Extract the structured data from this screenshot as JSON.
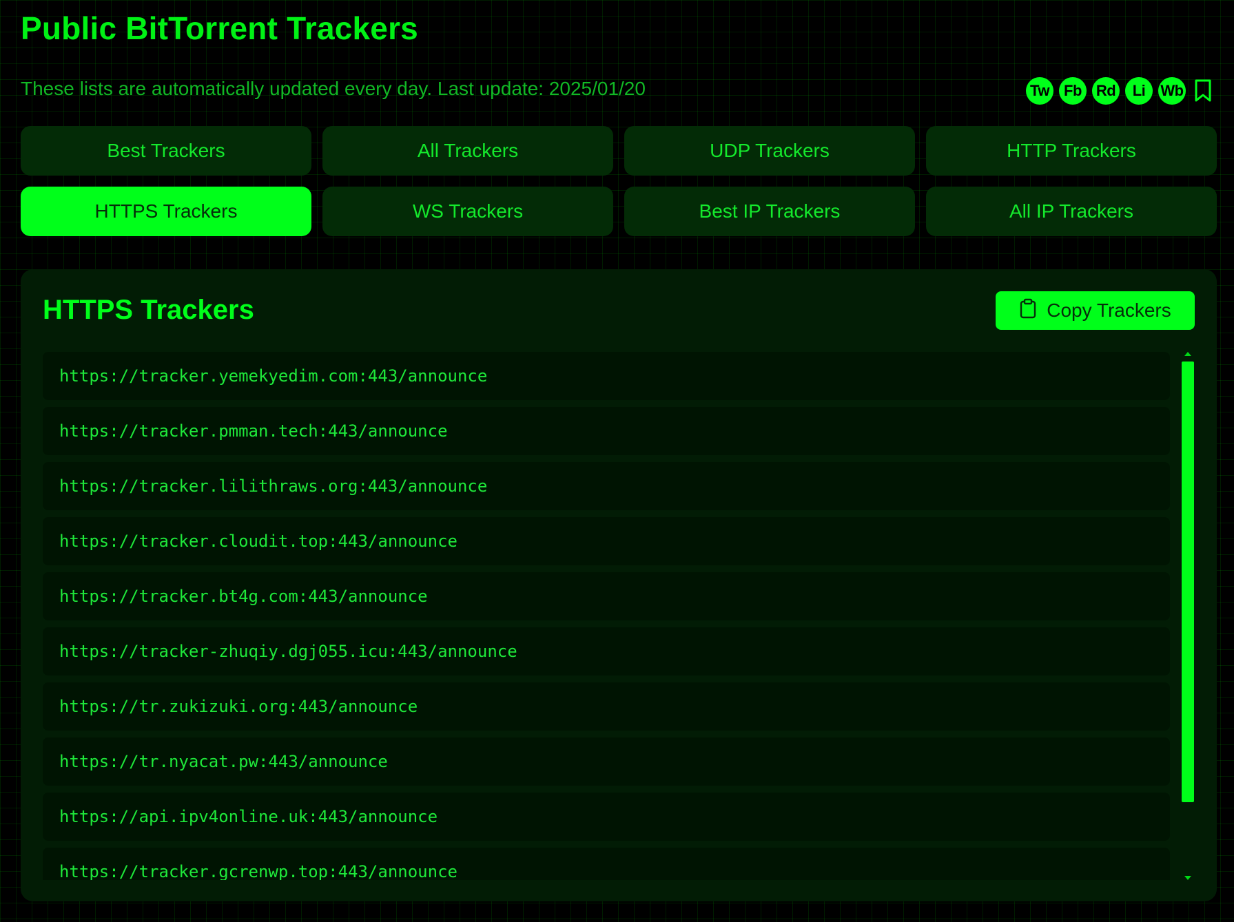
{
  "header": {
    "title": "Public BitTorrent Trackers",
    "subtitle": "These lists are automatically updated every day. Last update: 2025/01/20"
  },
  "share": {
    "icons": [
      {
        "label": "Tw",
        "name": "twitter-icon"
      },
      {
        "label": "Fb",
        "name": "facebook-icon"
      },
      {
        "label": "Rd",
        "name": "reddit-icon"
      },
      {
        "label": "Li",
        "name": "linkedin-icon"
      },
      {
        "label": "Wb",
        "name": "weibo-icon"
      }
    ],
    "bookmark_icon": "bookmark-icon"
  },
  "tabs": [
    {
      "label": "Best Trackers",
      "active": false
    },
    {
      "label": "All Trackers",
      "active": false
    },
    {
      "label": "UDP Trackers",
      "active": false
    },
    {
      "label": "HTTP Trackers",
      "active": false
    },
    {
      "label": "HTTPS Trackers",
      "active": true
    },
    {
      "label": "WS Trackers",
      "active": false
    },
    {
      "label": "Best IP Trackers",
      "active": false
    },
    {
      "label": "All IP Trackers",
      "active": false
    }
  ],
  "panel": {
    "title": "HTTPS Trackers",
    "copy_label": "Copy Trackers",
    "copy_icon": "clipboard-icon",
    "trackers": [
      "https://tracker.yemekyedim.com:443/announce",
      "https://tracker.pmman.tech:443/announce",
      "https://tracker.lilithraws.org:443/announce",
      "https://tracker.cloudit.top:443/announce",
      "https://tracker.bt4g.com:443/announce",
      "https://tracker-zhuqiy.dgj055.icu:443/announce",
      "https://tr.zukizuki.org:443/announce",
      "https://tr.nyacat.pw:443/announce",
      "https://api.ipv4online.uk:443/announce",
      "https://tracker.gcrenwp.top:443/announce"
    ]
  },
  "colors": {
    "background": "#000000",
    "accent": "#00ff1a",
    "tab_background": "#032b06",
    "panel_background": "#021c05",
    "row_background": "#001402"
  }
}
